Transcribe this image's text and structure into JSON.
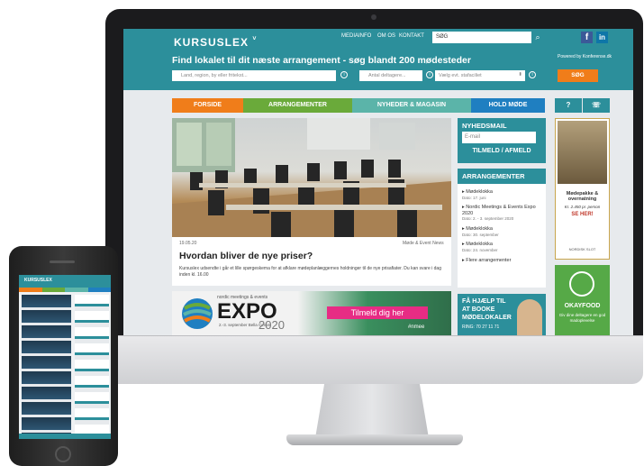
{
  "site": {
    "logo": "KURSUSLEX",
    "nav_top": [
      "MEDIAINFO",
      "OM OS",
      "KONTAKT"
    ],
    "search_placeholder": "SØG",
    "tagline": "Find lokalet til dit næste arrangement - søg blandt 200 mødesteder",
    "powered_by": "Powered by Konferense.dk",
    "filter_place": "Land, region, by eller fritekst...",
    "filter_participants": "Antal deltagere...",
    "filter_facility": "Vælg evt. stafaciliet",
    "filter_search": "SØG"
  },
  "nav": [
    {
      "label": "FORSIDE",
      "color": "#f07d1a"
    },
    {
      "label": "ARRANGEMENTER",
      "color": "#6aaa3a"
    },
    {
      "label": "NYHEDER & MAGASIN",
      "color": "#5bb4a9"
    },
    {
      "label": "HOLD MØDE",
      "color": "#1f7fc1"
    }
  ],
  "nav_right": {
    "q": "?"
  },
  "article": {
    "date": "19.05.20",
    "source": "Møde & Event News",
    "title": "Hvordan bliver de nye priser?",
    "text": "Kursuslex udsendte i går et lille spørgeskema for at afklare mødeplanlæggernes holdninger til de nye prisafiater. Du kan svare i dag inden kl. 16.00"
  },
  "banner": {
    "top": "nordic meetings & events",
    "expo": "EXPO",
    "dates": "2.-3. september",
    "venue": "Bella Center",
    "year": "2020",
    "cta": "Tilmeld dig her",
    "tag": "#nmee"
  },
  "newsletter": {
    "heading": "NYHEDSMAIL",
    "email_placeholder": "E-mail",
    "button": "TILMELD / AFMELD"
  },
  "events": {
    "heading": "ARRANGEMENTER",
    "items": [
      {
        "title": "Mødeklokka",
        "date": "Dato: 17. juni"
      },
      {
        "title": "Nordic Meetings & Events Expo 2020",
        "date": "Dato: 2. - 3. september 2020"
      },
      {
        "title": "Mødeklokka",
        "date": "Dato: 30. september"
      },
      {
        "title": "Mødeklokka",
        "date": "Dato: 24. november"
      },
      {
        "title": "Flere arrangementer",
        "date": ""
      }
    ]
  },
  "help": {
    "line1": "FÅ HJÆLP TIL",
    "line2": "AT BOOKE",
    "line3": "MØDELOKALER",
    "phone": "RING: 70 27 11 71"
  },
  "ads": {
    "ad1_title": "Mødepakke & overnatning",
    "ad1_price": "Kr. 2.450 pr. person",
    "ad1_cta": "SE HER!",
    "ad1_brand": "NORDISK SLOT",
    "ad2_brand": "OKAYFOOD",
    "ad2_text": "Giv dine deltagere en god madoplevelse"
  },
  "mobile": {
    "logo": "KURSUSLEX"
  }
}
